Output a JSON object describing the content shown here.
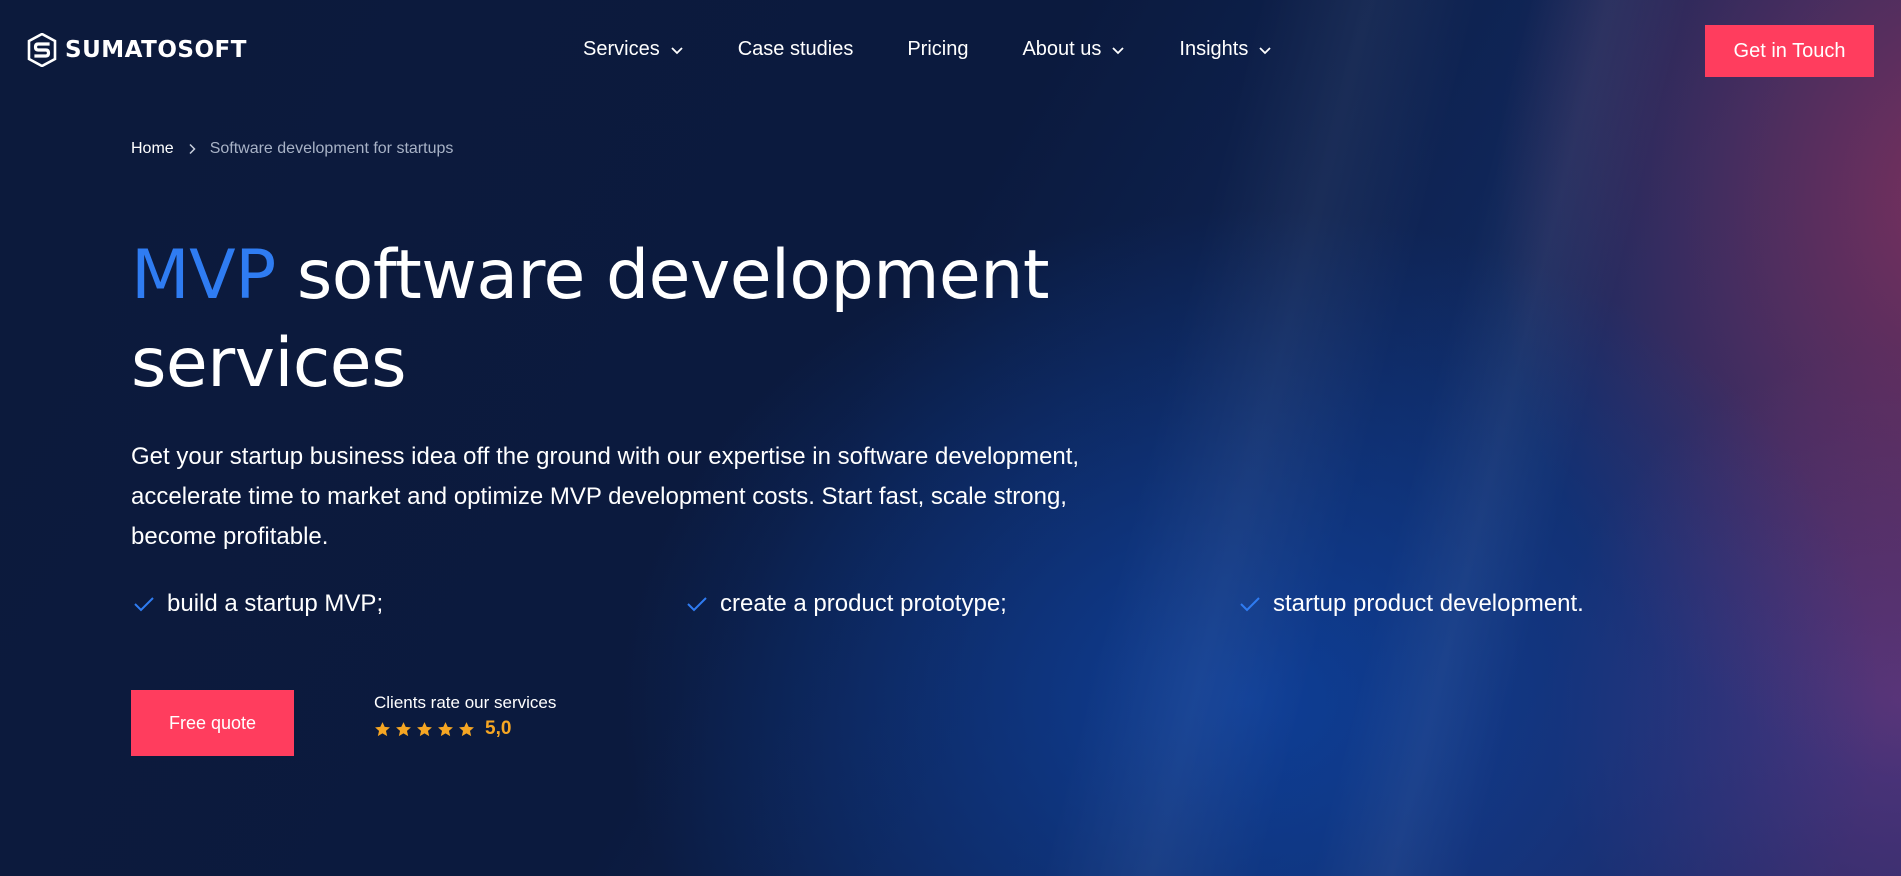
{
  "brand": {
    "name": "SUMATOSOFT"
  },
  "nav": {
    "items": [
      {
        "label": "Services",
        "dropdown": true
      },
      {
        "label": "Case studies",
        "dropdown": false
      },
      {
        "label": "Pricing",
        "dropdown": false
      },
      {
        "label": "About us",
        "dropdown": true
      },
      {
        "label": "Insights",
        "dropdown": true
      }
    ],
    "cta_label": "Get in Touch"
  },
  "breadcrumb": {
    "home": "Home",
    "current": "Software development for startups"
  },
  "hero": {
    "title_accent": "MVP",
    "title_rest": " software development services",
    "description": "Get your startup business idea off the ground with our expertise in software development, accelerate time to market and optimize MVP development costs. Start fast, scale strong, become profitable.",
    "features": [
      "build a startup MVP;",
      "create a product prototype;",
      "startup product development."
    ],
    "quote_label": "Free quote",
    "rating_label": "Clients rate our services",
    "rating_value": "5,0",
    "rating_stars": 5
  },
  "colors": {
    "accent": "#ff3d5e",
    "title_accent": "#2f7cf2",
    "star": "#f6a623",
    "background": "#0c1a3c"
  }
}
